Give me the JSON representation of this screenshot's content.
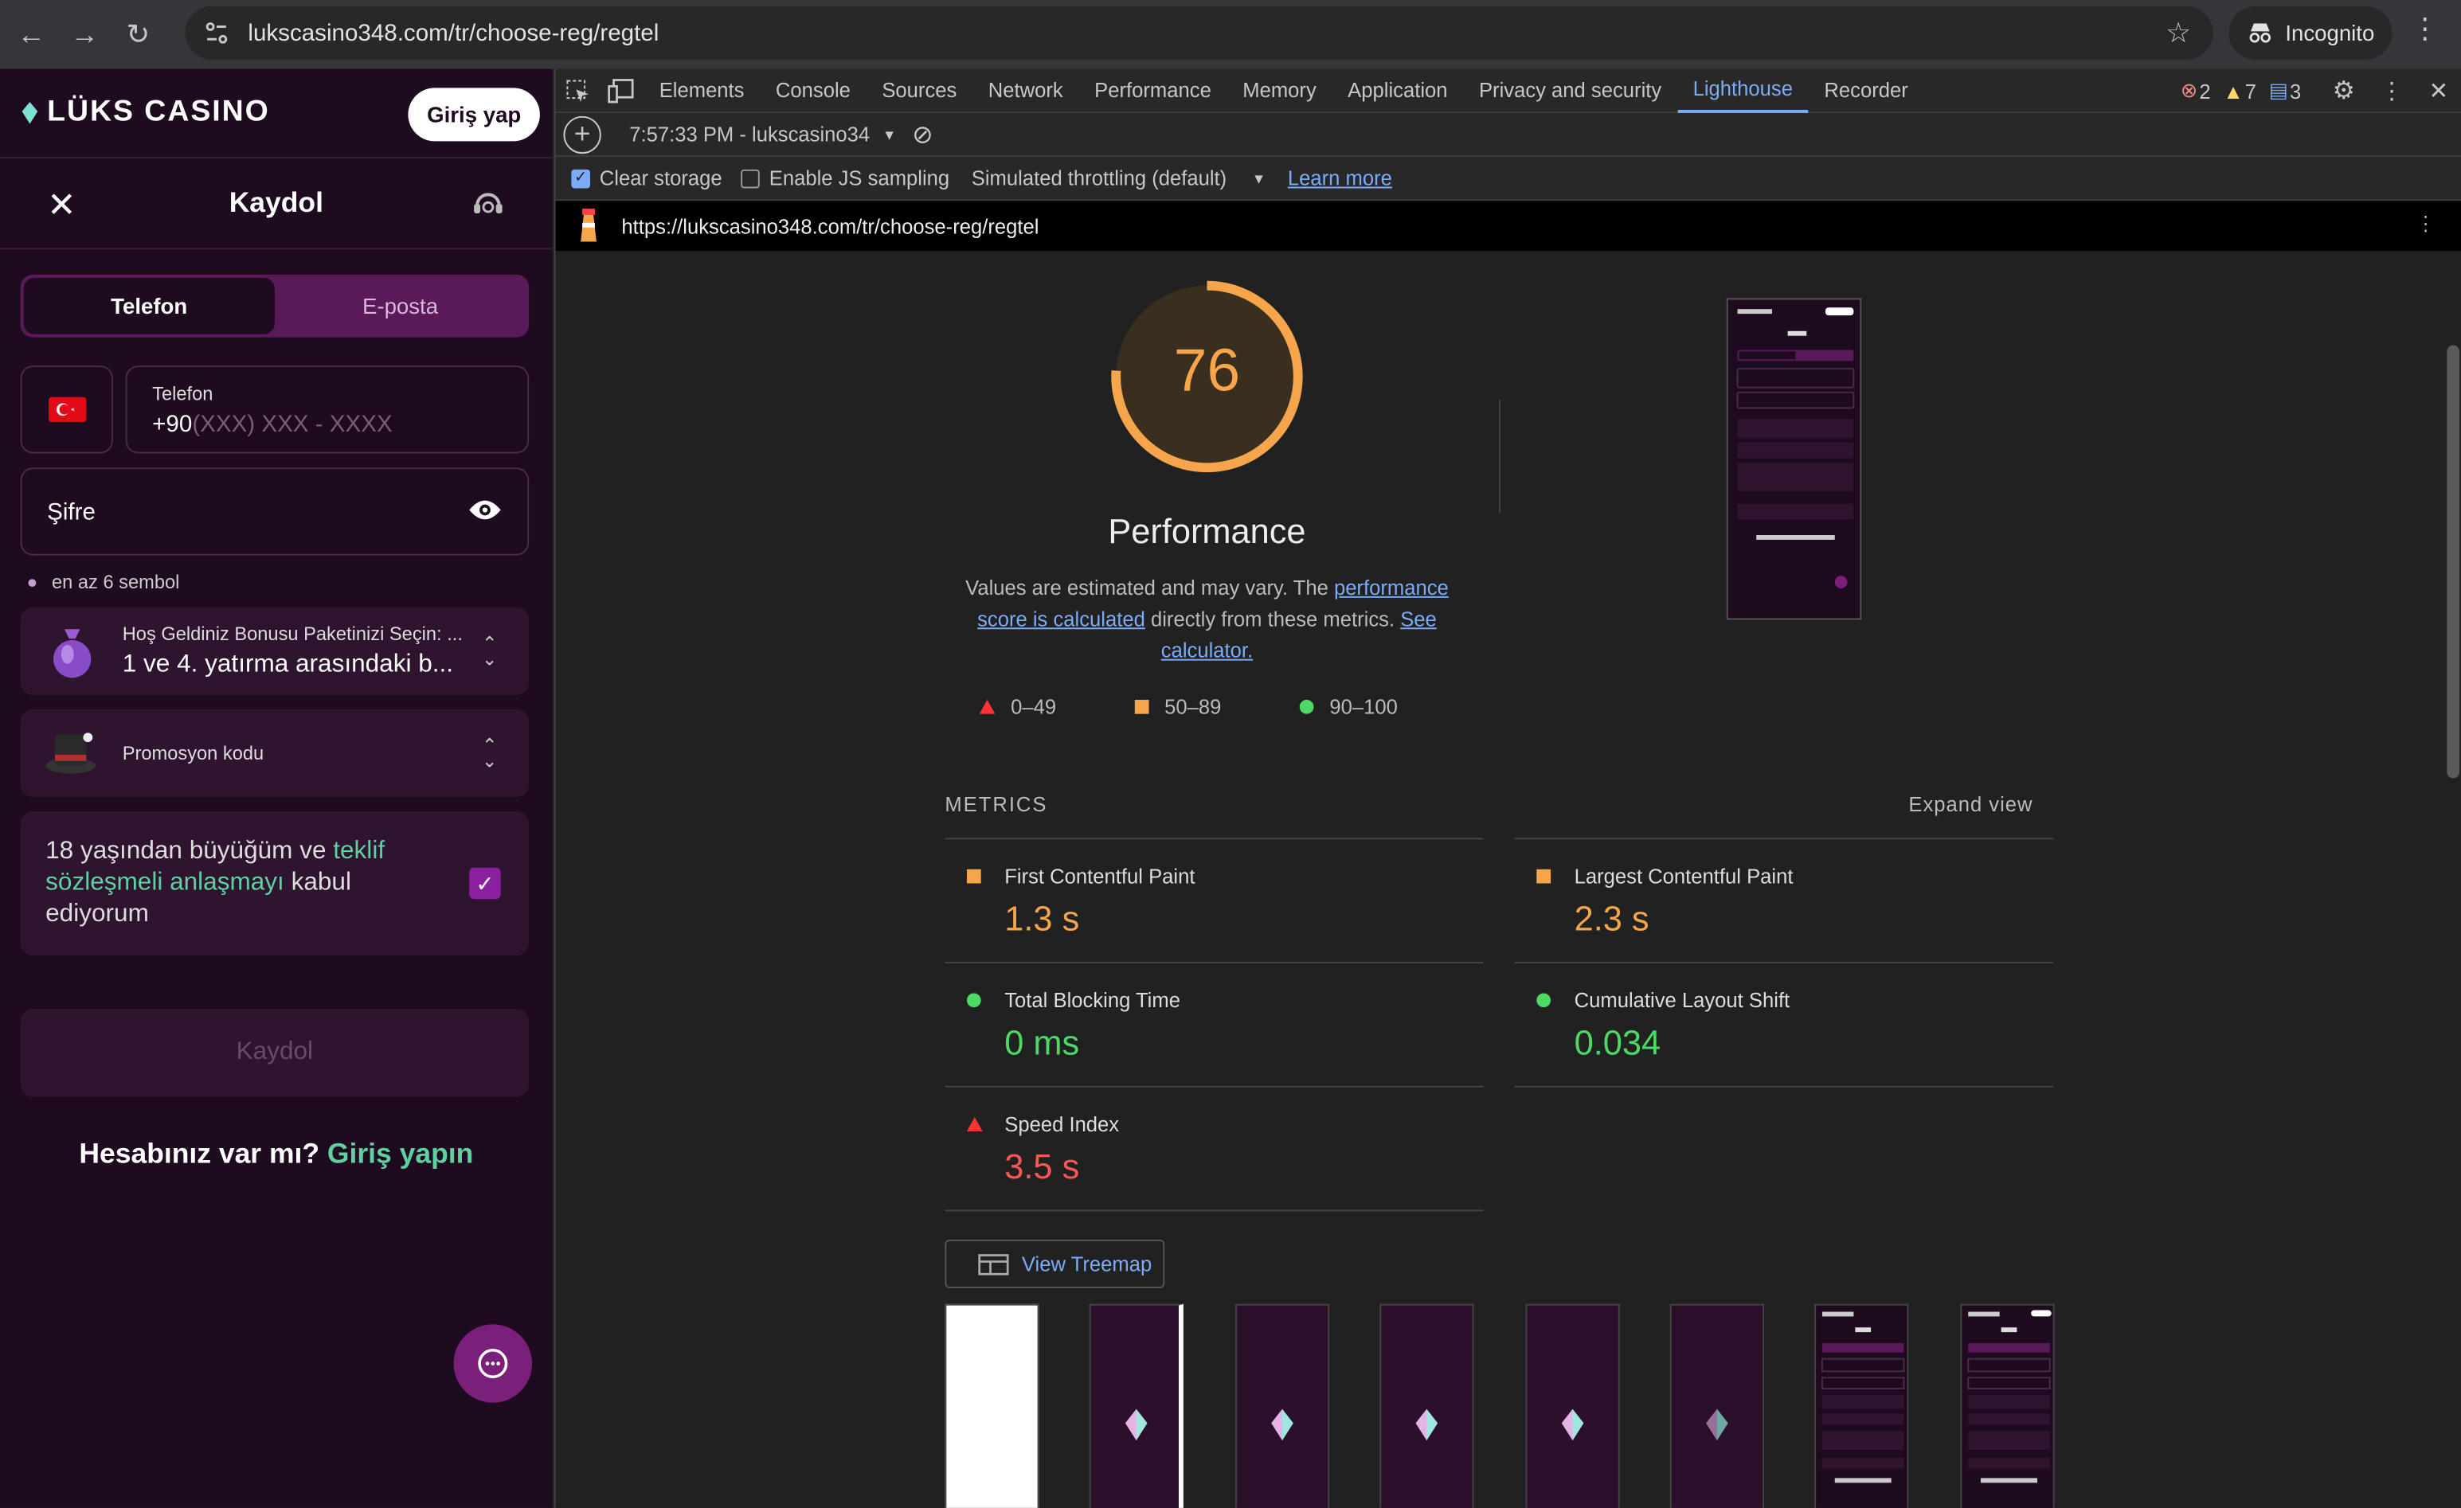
{
  "browser": {
    "url": "lukscasino348.com/tr/choose-reg/regtel",
    "incognito_label": "Incognito"
  },
  "site": {
    "logo_text": "LÜKS CASINO",
    "login_button": "Giriş yap",
    "register_title": "Kaydol",
    "tabs": [
      "Telefon",
      "E-posta"
    ],
    "phone_label": "Telefon",
    "phone_prefix": "+90",
    "phone_placeholder": "(XXX) XXX - XXXX",
    "password_label": "Şifre",
    "password_hint": "en az 6 sembol",
    "bonus_label": "Hoş Geldiniz Bonusu Paketinizi Seçin: ...",
    "bonus_value": "1 ve 4. yatırma arasındaki b...",
    "promo_label": "Promosyon kodu",
    "terms_before": "18 yaşından büyüğüm ve ",
    "terms_link": "teklif sözleşmeli anlaşmayı",
    "terms_after": " kabul ediyorum",
    "terms_checked": true,
    "submit_button": "Kaydol",
    "have_account": "Hesabınız var mı?",
    "have_account_link": "Giriş yapın"
  },
  "devtools": {
    "tabs": [
      "Elements",
      "Console",
      "Sources",
      "Network",
      "Performance",
      "Memory",
      "Application",
      "Privacy and security",
      "Lighthouse",
      "Recorder"
    ],
    "active_tab": "Lighthouse",
    "errors": "2",
    "warnings": "7",
    "messages": "3",
    "report_selector": "7:57:33 PM - lukscasino34",
    "clear_storage": "Clear storage",
    "enable_js_sampling": "Enable JS sampling",
    "throttling": "Simulated throttling (default)",
    "learn_more": "Learn more",
    "report_url": "https://lukscasino348.com/tr/choose-reg/regtel"
  },
  "lighthouse": {
    "score": "76",
    "score_fraction": 0.76,
    "category": "Performance",
    "desc_1": "Values are estimated and may vary. The ",
    "desc_link1": "performance score is calculated",
    "desc_2": " directly from these metrics. ",
    "desc_link2": "See calculator.",
    "legend": [
      "0–49",
      "50–89",
      "90–100"
    ],
    "metrics_title": "METRICS",
    "expand_view": "Expand view",
    "metrics": [
      {
        "label": "First Contentful Paint",
        "value": "1.3 s",
        "rating": "average"
      },
      {
        "label": "Largest Contentful Paint",
        "value": "2.3 s",
        "rating": "average"
      },
      {
        "label": "Total Blocking Time",
        "value": "0 ms",
        "rating": "pass"
      },
      {
        "label": "Cumulative Layout Shift",
        "value": "0.034",
        "rating": "pass"
      },
      {
        "label": "Speed Index",
        "value": "3.5 s",
        "rating": "fail"
      }
    ],
    "view_treemap": "View Treemap",
    "colors": {
      "fail": "#ff5555",
      "average": "#f7a54a",
      "pass": "#4cd964"
    }
  }
}
